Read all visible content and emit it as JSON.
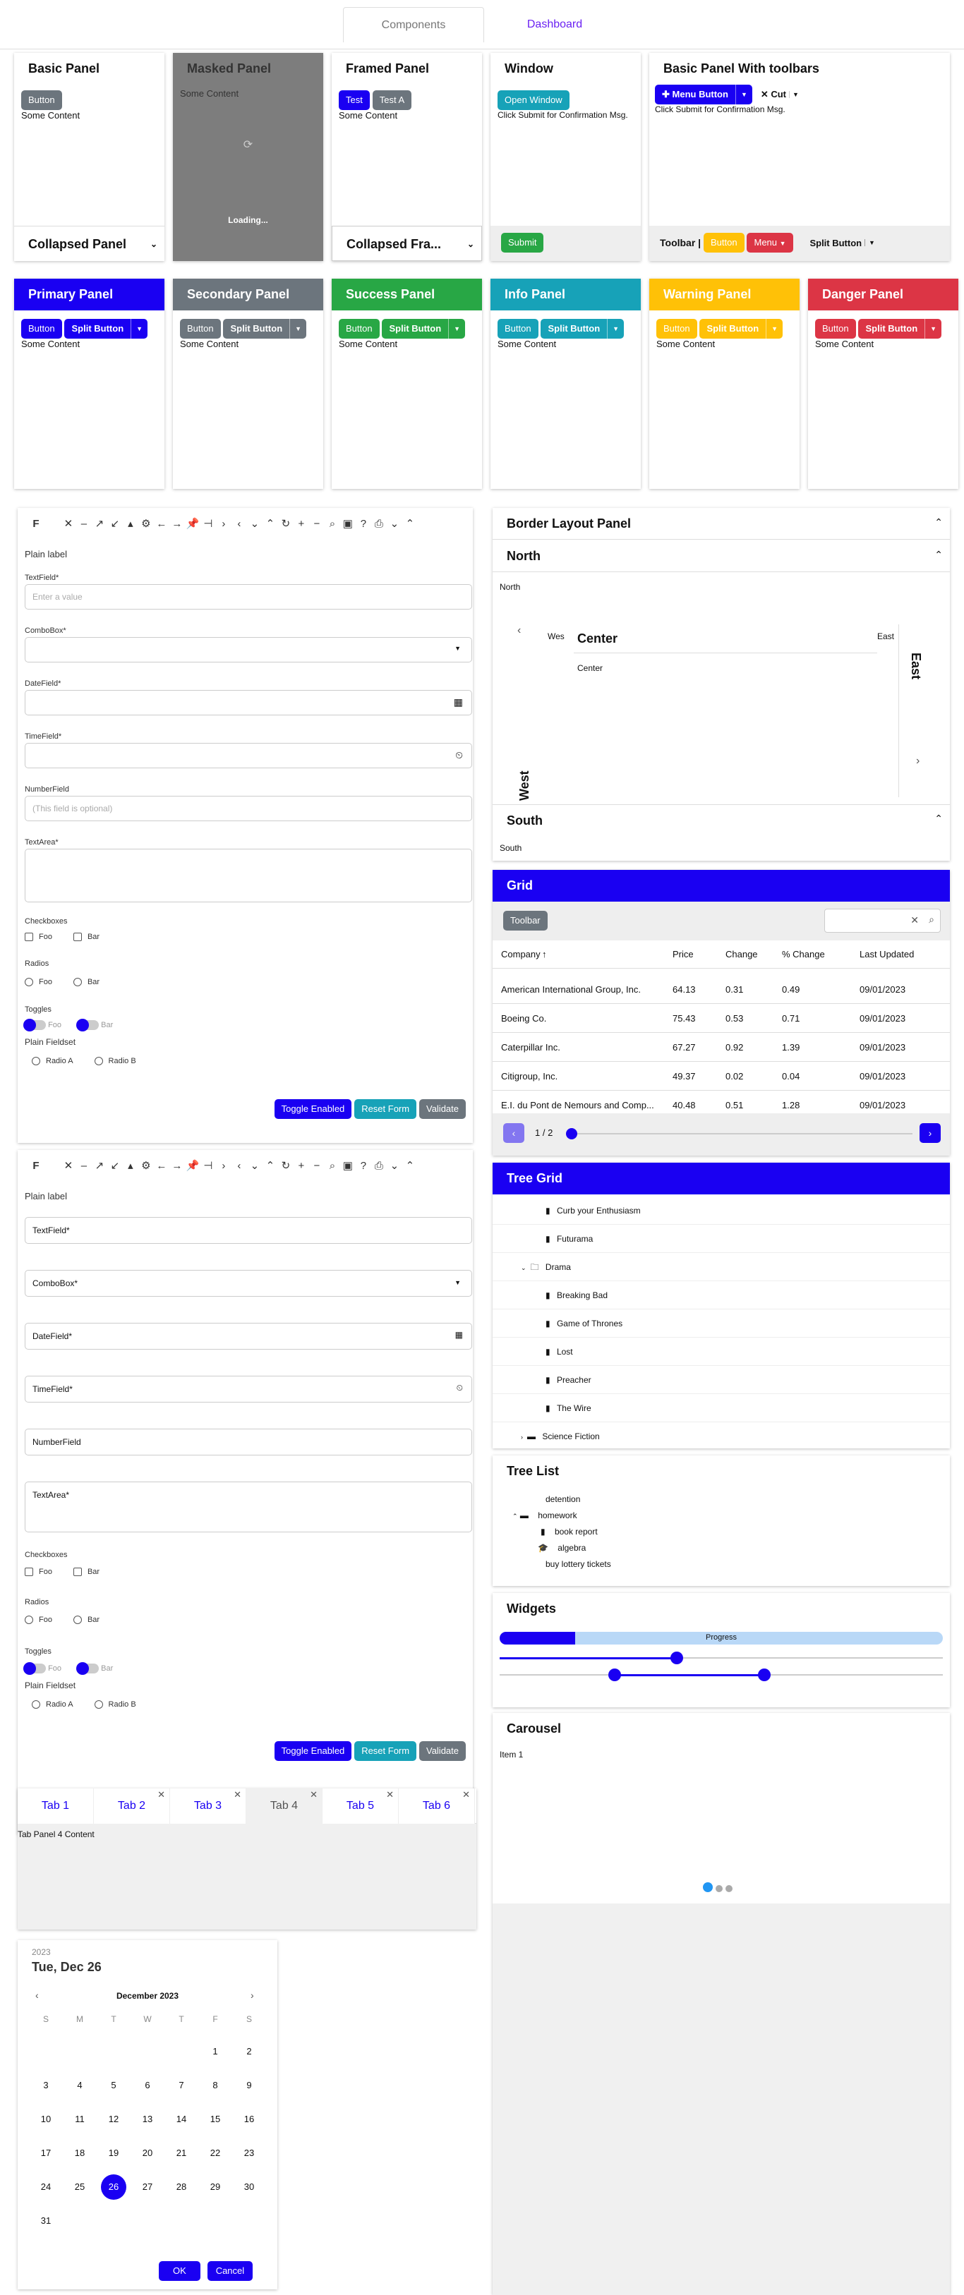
{
  "nav": {
    "tabs": [
      "Components",
      "Dashboard"
    ]
  },
  "row1": {
    "basic": {
      "title": "Basic Panel",
      "button": "Button",
      "content": "Some Content",
      "collapsed": "Collapsed Panel"
    },
    "masked": {
      "title": "Masked Panel",
      "content": "Some Content",
      "loading": "Loading..."
    },
    "framed": {
      "title": "Framed Panel",
      "btn1": "Test",
      "btn2": "Test A",
      "content": "Some Content",
      "collapsed": "Collapsed Fra..."
    },
    "window": {
      "title": "Window",
      "open": "Open Window",
      "msg": "Click Submit for Confirmation Msg.",
      "submit": "Submit"
    },
    "toolbars": {
      "title": "Basic Panel With toolbars",
      "menu": "Menu Button",
      "cut": "Cut",
      "msg": "Click Submit for Confirmation Msg.",
      "toolbar": "Toolbar |",
      "button": "Button",
      "menu2": "Menu",
      "split": "Split Button"
    }
  },
  "row2": [
    {
      "title": "Primary Panel",
      "color": "#1a00f2",
      "button": "Button",
      "split": "Split Button",
      "content": "Some Content"
    },
    {
      "title": "Secondary Panel",
      "color": "#6c757d",
      "button": "Button",
      "split": "Split Button",
      "content": "Some Content"
    },
    {
      "title": "Success Panel",
      "color": "#28a745",
      "button": "Button",
      "split": "Split Button",
      "content": "Some Content"
    },
    {
      "title": "Info Panel",
      "color": "#17a2b8",
      "button": "Button",
      "split": "Split Button",
      "content": "Some Content"
    },
    {
      "title": "Warning Panel",
      "color": "#ffc107",
      "button": "Button",
      "split": "Split Button",
      "content": "Some Content"
    },
    {
      "title": "Danger Panel",
      "color": "#dc3545",
      "button": "Button",
      "split": "Split Button",
      "content": "Some Content"
    }
  ],
  "form1": {
    "plain": "Plain label",
    "textfield": "TextField*",
    "textfield_ph": "Enter a value",
    "combobox": "ComboBox*",
    "datefield": "DateField*",
    "timefield": "TimeField*",
    "numberfield": "NumberField",
    "number_ph": "(This field is optional)",
    "textarea": "TextArea*",
    "checkboxes": "Checkboxes",
    "foo": "Foo",
    "bar": "Bar",
    "radios": "Radios",
    "toggles": "Toggles",
    "fieldset": "Plain Fieldset",
    "radioA": "Radio A",
    "radioB": "Radio B",
    "toggle_enabled": "Toggle Enabled",
    "reset": "Reset Form",
    "validate": "Validate"
  },
  "form2": {
    "plain": "Plain label",
    "textfield": "TextField*",
    "combobox": "ComboBox*",
    "datefield": "DateField*",
    "timefield": "TimeField*",
    "numberfield": "NumberField",
    "textarea": "TextArea*",
    "checkboxes": "Checkboxes",
    "foo": "Foo",
    "bar": "Bar",
    "radios": "Radios",
    "toggles": "Toggles",
    "fieldset": "Plain Fieldset",
    "radioA": "Radio A",
    "radioB": "Radio B",
    "toggle_enabled": "Toggle Enabled",
    "reset": "Reset Form",
    "validate": "Validate"
  },
  "border": {
    "title": "Border Layout Panel",
    "north": "North",
    "north_c": "North",
    "west_short": "Wes",
    "center": "Center",
    "center_c": "Center",
    "east_short": "East",
    "east": "East",
    "west": "West",
    "south": "South",
    "south_c": "South"
  },
  "grid": {
    "title": "Grid",
    "toolbar": "Toolbar",
    "cols": [
      "Company",
      "Price",
      "Change",
      "% Change",
      "Last Updated"
    ],
    "rows": [
      [
        "American International Group, Inc.",
        "64.13",
        "0.31",
        "0.49",
        "09/01/2023"
      ],
      [
        "Boeing Co.",
        "75.43",
        "0.53",
        "0.71",
        "09/01/2023"
      ],
      [
        "Caterpillar Inc.",
        "67.27",
        "0.92",
        "1.39",
        "09/01/2023"
      ],
      [
        "Citigroup, Inc.",
        "49.37",
        "0.02",
        "0.04",
        "09/01/2023"
      ],
      [
        "E.I. du Pont de Nemours and Comp...",
        "40.48",
        "0.51",
        "1.28",
        "09/01/2023"
      ]
    ],
    "page": "1 / 2"
  },
  "treegrid": {
    "title": "Tree Grid",
    "items": [
      "Curb your Enthusiasm",
      "Futurama",
      "Drama",
      "Breaking Bad",
      "Game of Thrones",
      "Lost",
      "Preacher",
      "The Wire",
      "Science Fiction"
    ]
  },
  "treelist": {
    "title": "Tree List",
    "items": [
      "detention",
      "homework",
      "book report",
      "algebra",
      "buy lottery tickets"
    ]
  },
  "widgets": {
    "title": "Widgets",
    "progress": "Progress",
    "progress_value": 0.17,
    "slider_value": 0.4
  },
  "carousel": {
    "title": "Carousel",
    "item": "Item 1"
  },
  "tabs": {
    "items": [
      "Tab 1",
      "Tab 2",
      "Tab 3",
      "Tab 4",
      "Tab 5",
      "Tab 6"
    ],
    "content": "Tab Panel 4 Content"
  },
  "calendar": {
    "year": "2023",
    "date": "Tue, Dec 26",
    "month": "December 2023",
    "days": [
      "S",
      "M",
      "T",
      "W",
      "T",
      "F",
      "S"
    ],
    "selected": "26",
    "ok": "OK",
    "cancel": "Cancel"
  }
}
